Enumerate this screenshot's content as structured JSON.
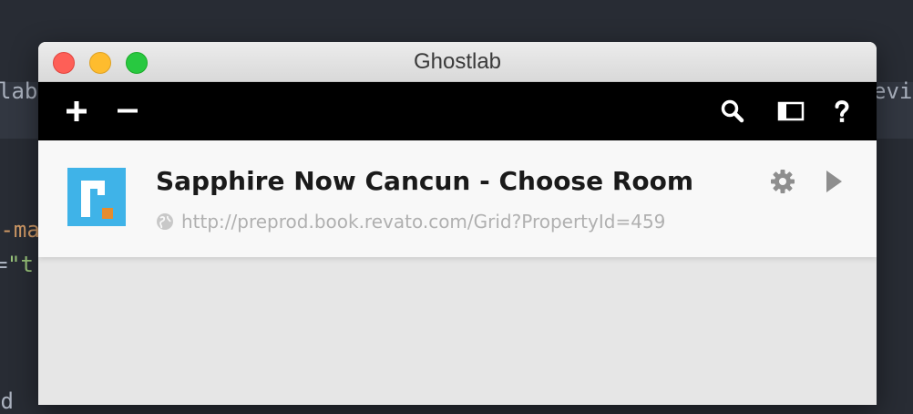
{
  "background_code": {
    "line1_left": "lab",
    "line1_right": "evi",
    "line2": "a-ma",
    "line3_eq": "=",
    "line3_str": "\"t",
    "line4": "ed "
  },
  "window": {
    "title": "Ghostlab"
  },
  "toolbar": {
    "add_icon": "plus-icon",
    "remove_icon": "minus-icon",
    "search_icon": "search-icon",
    "sidebar_icon": "sidebar-toggle-icon",
    "help_icon": "help-icon"
  },
  "sites": [
    {
      "name": "Sapphire Now Cancun - Choose Room",
      "url": "http://preprod.book.revato.com/Grid?PropertyId=459",
      "favicon_color": "#3fb3e8",
      "favicon_dot_color": "#e58c2e"
    }
  ],
  "colors": {
    "toolbar_bg": "#000000",
    "list_bg": "#e6e6e6",
    "item_bg": "#f8f8f8",
    "muted_icon": "#8e8e8e"
  }
}
